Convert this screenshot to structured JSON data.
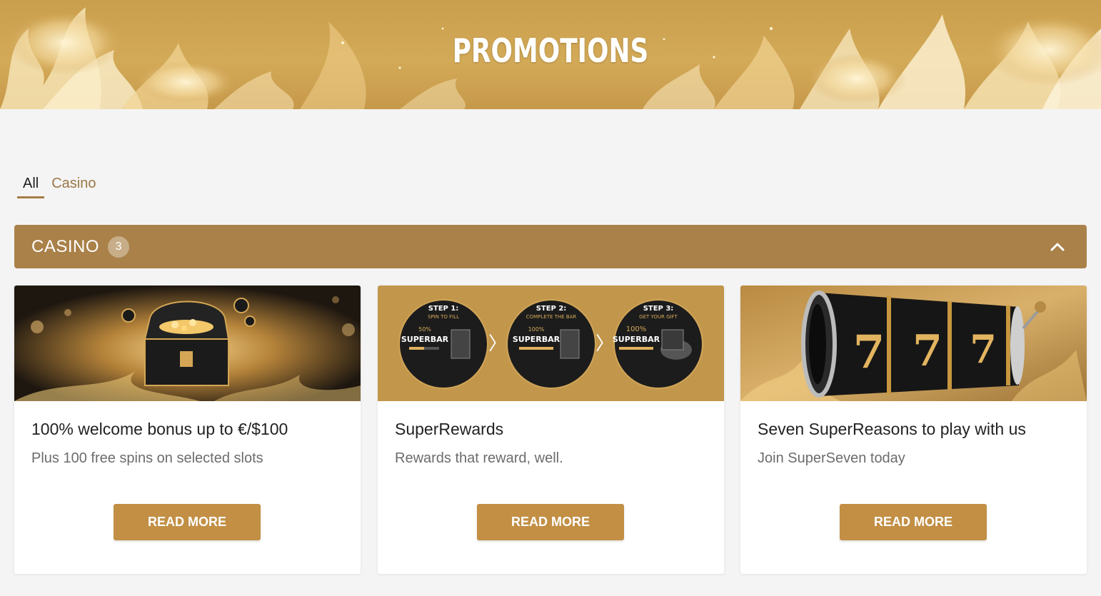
{
  "hero": {
    "title": "PROMOTIONS"
  },
  "tabs": [
    {
      "label": "All",
      "active": true
    },
    {
      "label": "Casino",
      "active": false
    }
  ],
  "category": {
    "title": "CASINO",
    "count": "3",
    "chevron_icon": "chevron-up-icon"
  },
  "cards": [
    {
      "title": "100% welcome bonus up to €/$100",
      "subtitle": "Plus 100 free spins on selected slots",
      "button": "READ MORE"
    },
    {
      "title": "SuperRewards",
      "subtitle": "Rewards that reward, well.",
      "button": "READ MORE",
      "steps": [
        {
          "step": "STEP 1:",
          "caption": "SPIN TO FILL",
          "percent": "50%",
          "label": "SUPERBAR"
        },
        {
          "step": "STEP 2:",
          "caption": "COMPLETE THE BAR",
          "percent": "100%",
          "label": "SUPERBAR"
        },
        {
          "step": "STEP 3:",
          "caption": "GET YOUR GIFT",
          "percent": "100%",
          "label": "SUPERBAR"
        }
      ]
    },
    {
      "title": "Seven SuperReasons to play with us",
      "subtitle": "Join SuperSeven today",
      "button": "READ MORE",
      "reel_digits": [
        "7",
        "7",
        "7"
      ]
    }
  ],
  "colors": {
    "accent": "#a98149",
    "button": "#c28f45",
    "hero": "#c99e4c",
    "background": "#f4f4f4"
  }
}
